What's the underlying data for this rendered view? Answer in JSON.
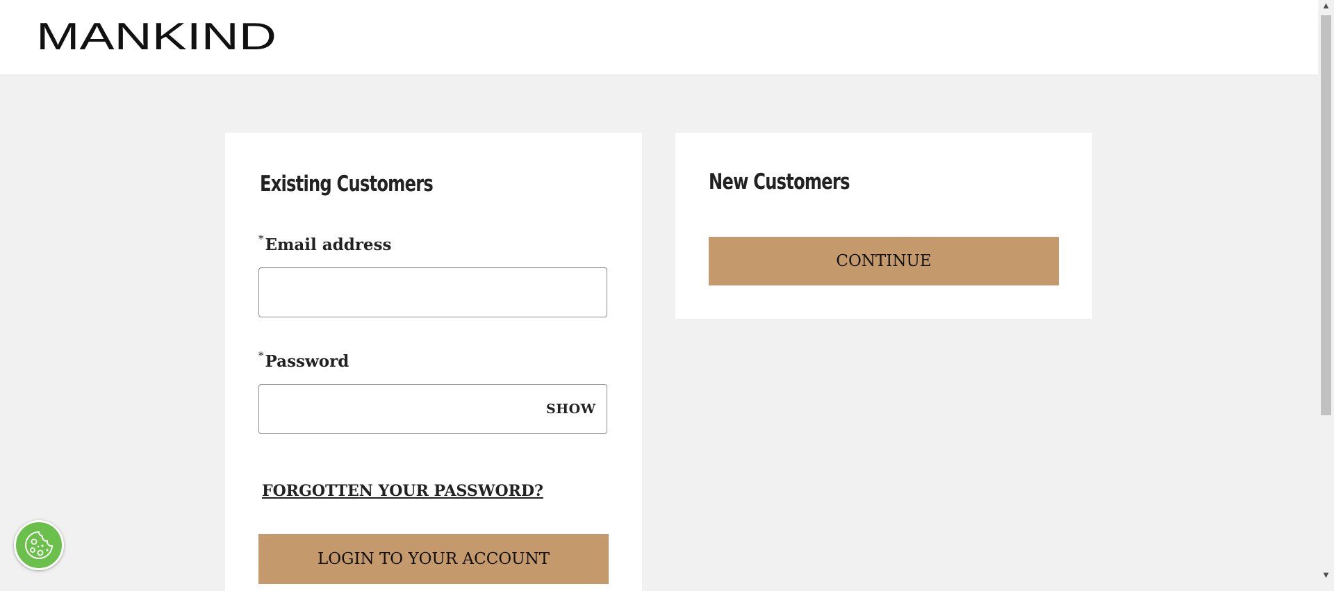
{
  "brand": {
    "logo_text": "MANKIND"
  },
  "existing_customers": {
    "title": "Existing Customers",
    "email_label": "Email address",
    "email_value": "",
    "password_label": "Password",
    "password_value": "",
    "required_marker": "*",
    "show_label": "SHOW",
    "forgot_label": "FORGOTTEN YOUR PASSWORD?",
    "login_label": "LOGIN TO YOUR ACCOUNT"
  },
  "new_customers": {
    "title": "New Customers",
    "continue_label": "CONTINUE"
  },
  "cookie_widget": {
    "icon": "cookie-icon"
  },
  "colors": {
    "accent_button": "#c49a6c",
    "cookie_green": "#6ac04b",
    "page_background": "#f1f1f1"
  }
}
